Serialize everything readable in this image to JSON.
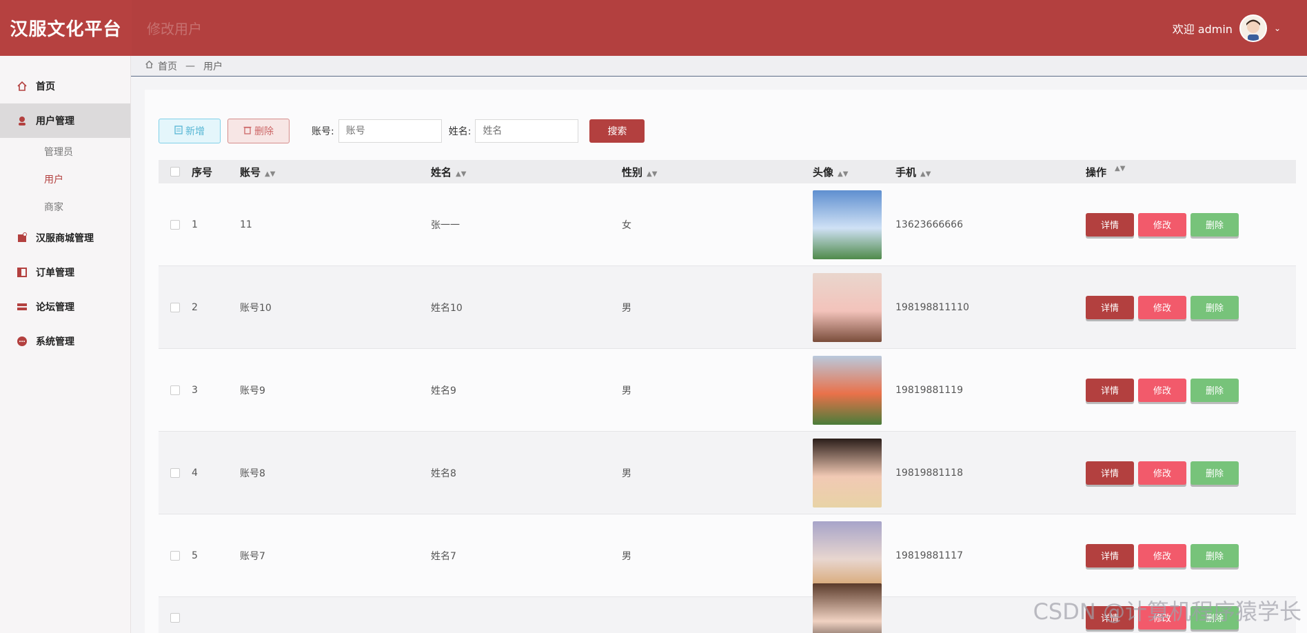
{
  "header": {
    "logo": "汉服文化平台",
    "faded_title": "修改用户",
    "welcome": "欢迎 admin",
    "caret": "⌄"
  },
  "sidebar": {
    "items": [
      {
        "label": "首页",
        "icon": "home-icon"
      },
      {
        "label": "用户管理",
        "icon": "user-icon",
        "active": true,
        "children": [
          {
            "label": "管理员"
          },
          {
            "label": "用户",
            "active": true
          },
          {
            "label": "商家"
          }
        ]
      },
      {
        "label": "汉服商城管理",
        "icon": "shop-icon"
      },
      {
        "label": "订单管理",
        "icon": "order-icon"
      },
      {
        "label": "论坛管理",
        "icon": "forum-icon"
      },
      {
        "label": "系统管理",
        "icon": "system-icon"
      }
    ]
  },
  "breadcrumb": {
    "home": "首页",
    "sep": "—",
    "current": "用户"
  },
  "toolbar": {
    "new_label": "新增",
    "delete_label": "删除",
    "account_label": "账号:",
    "account_placeholder": "账号",
    "name_label": "姓名:",
    "name_placeholder": "姓名",
    "search_label": "搜索"
  },
  "table": {
    "headers": {
      "no": "序号",
      "account": "账号",
      "name": "姓名",
      "gender": "性别",
      "avatar": "头像",
      "phone": "手机",
      "ops": "操作"
    },
    "ops": {
      "detail": "详情",
      "edit": "修改",
      "delete": "删除"
    },
    "rows": [
      {
        "no": "1",
        "account": "11",
        "name": "张一一",
        "gender": "女",
        "phone": "13623666666",
        "thumb": [
          "#5f8fd0",
          "#cfe1f5",
          "#4f8a4a"
        ]
      },
      {
        "no": "2",
        "account": "账号10",
        "name": "姓名10",
        "gender": "男",
        "phone": "198198811110",
        "thumb": [
          "#e9d6cd",
          "#f3c3bb",
          "#7a4d3b"
        ]
      },
      {
        "no": "3",
        "account": "账号9",
        "name": "姓名9",
        "gender": "男",
        "phone": "19819881119",
        "thumb": [
          "#b9c9dc",
          "#e9714a",
          "#4a7d3a"
        ]
      },
      {
        "no": "4",
        "account": "账号8",
        "name": "姓名8",
        "gender": "男",
        "phone": "19819881118",
        "thumb": [
          "#2b1e1a",
          "#f1c9b4",
          "#e8d3a6"
        ]
      },
      {
        "no": "5",
        "account": "账号7",
        "name": "姓名7",
        "gender": "男",
        "phone": "19819881117",
        "thumb": [
          "#a7a4c9",
          "#e8d6cf",
          "#d6a26a"
        ]
      },
      {
        "no": "",
        "account": "",
        "name": "",
        "gender": "",
        "phone": "",
        "thumb": [
          "#5a3a2a",
          "#f0d2c2",
          "#2b1e1a"
        ]
      }
    ]
  },
  "watermark": "CSDN @计算机程序猿学长"
}
